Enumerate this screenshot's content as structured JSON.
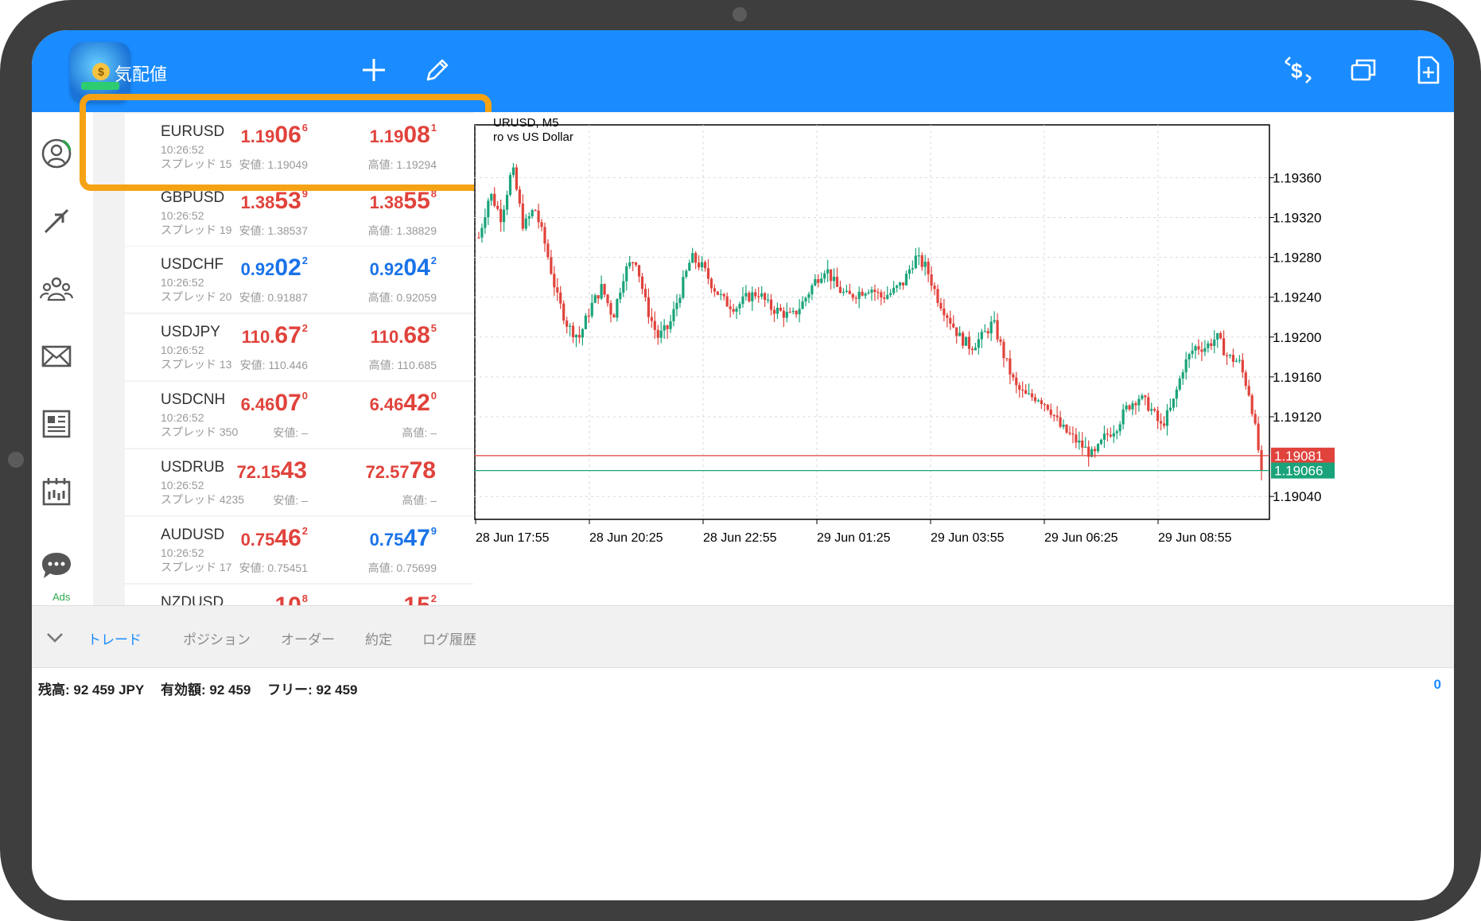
{
  "app": {
    "title": "気配値"
  },
  "sidebar": {
    "ads_label": "Ads"
  },
  "quotes": [
    {
      "symbol": "EURUSD",
      "time": "10:26:52",
      "spread": "スプレッド 15",
      "bid_base": "1.19",
      "bid_big": "06",
      "bid_sup": "6",
      "bid_color": "red",
      "ask_base": "1.19",
      "ask_big": "08",
      "ask_sup": "1",
      "ask_color": "red",
      "low": "安値: 1.19049",
      "high": "高値: 1.19294"
    },
    {
      "symbol": "GBPUSD",
      "time": "10:26:52",
      "spread": "スプレッド 19",
      "bid_base": "1.38",
      "bid_big": "53",
      "bid_sup": "9",
      "bid_color": "red",
      "ask_base": "1.38",
      "ask_big": "55",
      "ask_sup": "8",
      "ask_color": "red",
      "low": "安値: 1.38537",
      "high": "高値: 1.38829"
    },
    {
      "symbol": "USDCHF",
      "time": "10:26:52",
      "spread": "スプレッド 20",
      "bid_base": "0.92",
      "bid_big": "02",
      "bid_sup": "2",
      "bid_color": "blue",
      "ask_base": "0.92",
      "ask_big": "04",
      "ask_sup": "2",
      "ask_color": "blue",
      "low": "安値: 0.91887",
      "high": "高値: 0.92059"
    },
    {
      "symbol": "USDJPY",
      "time": "10:26:52",
      "spread": "スプレッド 13",
      "bid_base": "110.",
      "bid_big": "67",
      "bid_sup": "2",
      "bid_color": "red",
      "ask_base": "110.",
      "ask_big": "68",
      "ask_sup": "5",
      "ask_color": "red",
      "low": "安値: 110.446",
      "high": "高値: 110.685"
    },
    {
      "symbol": "USDCNH",
      "time": "10:26:52",
      "spread": "スプレッド 350",
      "bid_base": "6.46",
      "bid_big": "07",
      "bid_sup": "0",
      "bid_color": "red",
      "ask_base": "6.46",
      "ask_big": "42",
      "ask_sup": "0",
      "ask_color": "red",
      "low": "安値: –",
      "high": "高値: –"
    },
    {
      "symbol": "USDRUB",
      "time": "10:26:52",
      "spread": "スプレッド 4235",
      "bid_base": "72.15",
      "bid_big": "43",
      "bid_sup": "",
      "bid_color": "red",
      "ask_base": "72.57",
      "ask_big": "78",
      "ask_sup": "",
      "ask_color": "red",
      "low": "安値: –",
      "high": "高値: –"
    },
    {
      "symbol": "AUDUSD",
      "time": "10:26:52",
      "spread": "スプレッド 17",
      "bid_base": "0.75",
      "bid_big": "46",
      "bid_sup": "2",
      "bid_color": "red",
      "ask_base": "0.75",
      "ask_big": "47",
      "ask_sup": "9",
      "ask_color": "blue",
      "low": "安値: 0.75451",
      "high": "高値: 0.75699"
    },
    {
      "symbol": "NZDUSD",
      "time": "",
      "spread": "",
      "bid_base": "",
      "bid_big": "10",
      "bid_sup": "8",
      "bid_color": "red",
      "ask_base": "",
      "ask_big": "15",
      "ask_sup": "2",
      "ask_color": "red",
      "low": "",
      "high": ""
    }
  ],
  "chart": {
    "title": "URUSD, M5",
    "subtitle": "ro vs US Dollar",
    "colors": {
      "up": "#1aa37a",
      "down": "#e0433c",
      "grid": "#d9d9d9",
      "bid_line": "#e0433c",
      "ask_line": "#1aa37a"
    }
  },
  "chart_data": {
    "type": "candlestick",
    "y_ticks": [
      "1.19360",
      "1.19320",
      "1.19280",
      "1.19240",
      "1.19200",
      "1.19160",
      "1.19120",
      "1.19040"
    ],
    "x_ticks": [
      "28 Jun 17:55",
      "28 Jun 20:25",
      "28 Jun 22:55",
      "29 Jun 01:25",
      "29 Jun 03:55",
      "29 Jun 06:25",
      "29 Jun 08:55"
    ],
    "ylim": [
      1.19017,
      1.19413
    ],
    "current_prices": [
      {
        "value": 1.19081,
        "label": "1.19081",
        "color": "#e0433c"
      },
      {
        "value": 1.19066,
        "label": "1.19066",
        "color": "#1aa37a"
      }
    ],
    "close_path": [
      1.193,
      1.19345,
      1.1932,
      1.1937,
      1.1931,
      1.1933,
      1.1929,
      1.1924,
      1.1921,
      1.192,
      1.1923,
      1.1925,
      1.1922,
      1.19265,
      1.1928,
      1.1923,
      1.192,
      1.1921,
      1.19245,
      1.1928,
      1.1927,
      1.1925,
      1.19235,
      1.1923,
      1.1924,
      1.19245,
      1.1923,
      1.19225,
      1.1922,
      1.19235,
      1.19255,
      1.1927,
      1.1925,
      1.1924,
      1.19245,
      1.1925,
      1.1924,
      1.19245,
      1.19255,
      1.1928,
      1.1927,
      1.1924,
      1.1922,
      1.192,
      1.1919,
      1.192,
      1.19215,
      1.1918,
      1.1915,
      1.1914,
      1.1914,
      1.1913,
      1.1911,
      1.191,
      1.1909,
      1.1908,
      1.191,
      1.1911,
      1.1913,
      1.1914,
      1.1913,
      1.1911,
      1.1913,
      1.1917,
      1.1919,
      1.1919,
      1.192,
      1.1918,
      1.19175,
      1.1914,
      1.19066
    ]
  },
  "bottom": {
    "tabs": [
      "トレード",
      "ポジション",
      "オーダー",
      "約定",
      "ログ履歴"
    ],
    "active_tab": 0,
    "balance": "残高:  92 459 JPY",
    "equity": "有効額:  92 459",
    "free": "フリー:  92 459",
    "profit": "0"
  }
}
